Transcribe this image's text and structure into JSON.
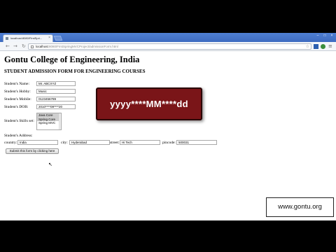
{
  "browser": {
    "tab_title": "localhost:8080/FirstSpri...",
    "tab_close": "×",
    "url_host": "localhost",
    "url_path": ":8080/FirstSpringMVCProject/admissionForm.html",
    "nav": {
      "back": "←",
      "forward": "→",
      "reload": "↻"
    },
    "window_controls": [
      "–",
      "□",
      "×"
    ]
  },
  "page": {
    "college_title": "Gontu College of Engineering, India",
    "form_title": "STUDENT ADMISSION FORM FOR ENGINEERING COURSES",
    "fields": {
      "name_label": "Student's Name:",
      "name_value": "Mr. ABCXYZ",
      "hobby_label": "Student's Hobby:",
      "hobby_value": "Music",
      "mobile_label": "Student's Mobile:",
      "mobile_value": "0123456789",
      "dob_label": "Student's DOB:",
      "dob_value": "2010****09****20",
      "skills_label": "Student's Skills set:",
      "skills_options": [
        "Java Core",
        "Spring Core",
        "Spring MVC"
      ],
      "address_label": "Student's Address:",
      "country_label": "country:",
      "country_value": "India",
      "city_label": "city:",
      "city_value": "Hyderabad",
      "street_label": "street:",
      "street_value": "Hi Tech",
      "pincode_label": "pincode:",
      "pincode_value": "500031"
    },
    "submit_label": "Submit this form by clicking here"
  },
  "overlay": {
    "date_format": "yyyy****MM****dd",
    "color": "#7a1518"
  },
  "watermark": "www.gontu.org"
}
